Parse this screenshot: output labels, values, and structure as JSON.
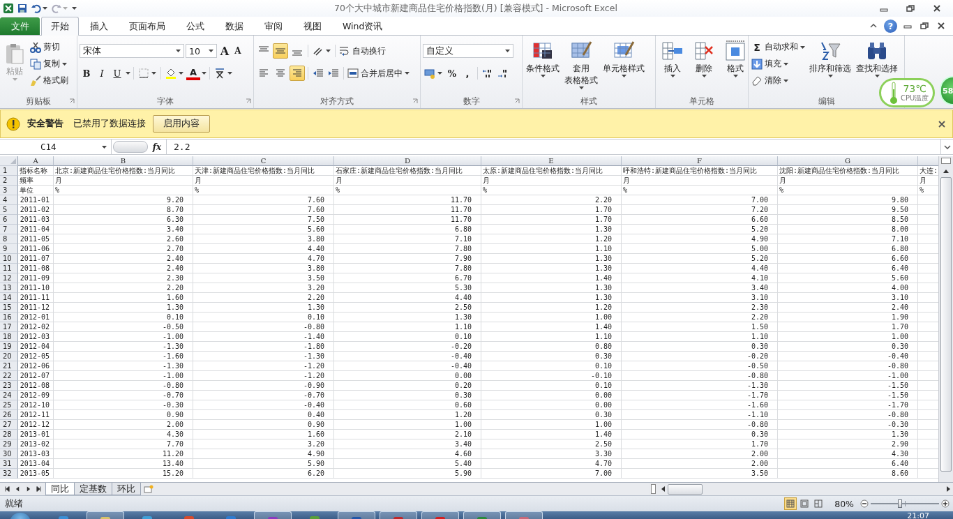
{
  "title_bar": {
    "title": "70个大中城市新建商品住宅价格指数(月)  [兼容模式]  -  Microsoft Excel"
  },
  "ribbon_tabs": [
    {
      "label": "文件",
      "kind": "file",
      "selected": false
    },
    {
      "label": "开始",
      "kind": "tab",
      "selected": true
    },
    {
      "label": "插入",
      "kind": "tab",
      "selected": false
    },
    {
      "label": "页面布局",
      "kind": "tab",
      "selected": false
    },
    {
      "label": "公式",
      "kind": "tab",
      "selected": false
    },
    {
      "label": "数据",
      "kind": "tab",
      "selected": false
    },
    {
      "label": "审阅",
      "kind": "tab",
      "selected": false
    },
    {
      "label": "视图",
      "kind": "tab",
      "selected": false
    },
    {
      "label": "Wind资讯",
      "kind": "tab",
      "selected": false
    }
  ],
  "help_glyph": "?",
  "clipboard": {
    "label": "剪贴板",
    "paste": {
      "label": "粘贴",
      "disabled": true
    },
    "items": [
      {
        "label": "剪切",
        "kind": "cut",
        "dropdown": false
      },
      {
        "label": "复制",
        "kind": "copy",
        "dropdown": true
      },
      {
        "label": "格式刷",
        "kind": "brush",
        "dropdown": false
      }
    ]
  },
  "font": {
    "label": "字体",
    "name": "宋体",
    "size": "10",
    "grow": "A",
    "shrink": "A",
    "styles": [
      {
        "label": "B",
        "kind": "bold"
      },
      {
        "label": "I",
        "kind": "italic"
      },
      {
        "label": "U",
        "kind": "underline"
      }
    ],
    "font_color": "A"
  },
  "alignment": {
    "label": "对齐方式",
    "vertical": [
      {
        "kind": "top",
        "selected": false
      },
      {
        "kind": "middle",
        "selected": true
      },
      {
        "kind": "bottom",
        "selected": false
      }
    ],
    "horizontal": [
      {
        "kind": "left",
        "selected": false
      },
      {
        "kind": "center",
        "selected": false
      },
      {
        "kind": "right",
        "selected": true
      }
    ],
    "wrap": "自动换行",
    "merge": "合并后居中"
  },
  "number": {
    "label": "数字",
    "format": "自定义",
    "percent": "%",
    "comma": ","
  },
  "styles": {
    "label": "样式",
    "items": [
      {
        "lines": [
          "条件格式"
        ],
        "kind": "conditional"
      },
      {
        "lines": [
          "套用",
          "表格格式"
        ],
        "kind": "table"
      },
      {
        "lines": [
          "单元格样式"
        ],
        "kind": "cellstyle"
      }
    ]
  },
  "cells": {
    "label": "单元格",
    "items": [
      {
        "label": "插入",
        "kind": "insert"
      },
      {
        "label": "删除",
        "kind": "delete"
      },
      {
        "label": "格式",
        "kind": "format"
      }
    ]
  },
  "editing": {
    "label": "编辑",
    "sum_glyph": "Σ",
    "small": [
      {
        "label": "自动求和",
        "kind": "sum"
      },
      {
        "label": "填充",
        "kind": "fill"
      },
      {
        "label": "清除",
        "kind": "clear"
      }
    ],
    "large": [
      {
        "label": "排序和筛选",
        "kind": "sort"
      },
      {
        "label": "查找和选择",
        "kind": "find"
      }
    ]
  },
  "cpu_widget": {
    "temperature": "73℃",
    "label": "CPU温度"
  },
  "badge": "58",
  "security_bar": {
    "title": "安全警告",
    "message": "已禁用了数据连接",
    "button": "启用内容"
  },
  "formula_bar": {
    "name_box": "C14",
    "function_glyph": "fx",
    "value": "2.2"
  },
  "sheet": {
    "columns": [
      "A",
      "B",
      "C",
      "D",
      "E",
      "F",
      "G"
    ],
    "rows": [
      {
        "number": "1",
        "kind": "text",
        "cells": [
          "指标名称",
          "北京:新建商品住宅价格指数:当月同比",
          "天津:新建商品住宅价格指数:当月同比",
          "石家庄:新建商品住宅价格指数:当月同比",
          "太原:新建商品住宅价格指数:当月同比",
          "呼和浩特:新建商品住宅价格指数:当月同比",
          "沈阳:新建商品住宅价格指数:当月同比",
          "大连:"
        ]
      },
      {
        "number": "2",
        "kind": "text",
        "cells": [
          "频率",
          "月",
          "月",
          "月",
          "月",
          "月",
          "月",
          "月"
        ]
      },
      {
        "number": "3",
        "kind": "text",
        "cells": [
          "单位",
          "%",
          "%",
          "%",
          "%",
          "%",
          "%",
          "%"
        ]
      },
      {
        "number": "4",
        "kind": "data",
        "cells": [
          "2011-01",
          "9.20",
          "7.60",
          "11.70",
          "2.20",
          "7.00",
          "9.80"
        ]
      },
      {
        "number": "5",
        "kind": "data",
        "cells": [
          "2011-02",
          "8.70",
          "7.60",
          "11.70",
          "1.70",
          "7.20",
          "9.50"
        ]
      },
      {
        "number": "6",
        "kind": "data",
        "cells": [
          "2011-03",
          "6.30",
          "7.50",
          "11.70",
          "1.70",
          "6.60",
          "8.50"
        ]
      },
      {
        "number": "7",
        "kind": "data",
        "cells": [
          "2011-04",
          "3.40",
          "5.60",
          "6.80",
          "1.30",
          "5.20",
          "8.00"
        ]
      },
      {
        "number": "8",
        "kind": "data",
        "cells": [
          "2011-05",
          "2.60",
          "3.80",
          "7.10",
          "1.20",
          "4.90",
          "7.10"
        ]
      },
      {
        "number": "9",
        "kind": "data",
        "cells": [
          "2011-06",
          "2.70",
          "4.40",
          "7.80",
          "1.10",
          "5.00",
          "6.80"
        ]
      },
      {
        "number": "10",
        "kind": "data",
        "cells": [
          "2011-07",
          "2.40",
          "4.70",
          "7.90",
          "1.30",
          "5.20",
          "6.60"
        ]
      },
      {
        "number": "11",
        "kind": "data",
        "cells": [
          "2011-08",
          "2.40",
          "3.80",
          "7.80",
          "1.30",
          "4.40",
          "6.40"
        ]
      },
      {
        "number": "12",
        "kind": "data",
        "cells": [
          "2011-09",
          "2.30",
          "3.50",
          "6.70",
          "1.40",
          "4.10",
          "5.60"
        ]
      },
      {
        "number": "13",
        "kind": "data",
        "cells": [
          "2011-10",
          "2.20",
          "3.20",
          "5.30",
          "1.30",
          "3.40",
          "4.00"
        ]
      },
      {
        "number": "14",
        "kind": "data",
        "cells": [
          "2011-11",
          "1.60",
          "2.20",
          "4.40",
          "1.30",
          "3.10",
          "3.10"
        ]
      },
      {
        "number": "15",
        "kind": "data",
        "cells": [
          "2011-12",
          "1.30",
          "1.30",
          "2.50",
          "1.20",
          "2.30",
          "2.40"
        ]
      },
      {
        "number": "16",
        "kind": "data",
        "cells": [
          "2012-01",
          "0.10",
          "0.10",
          "1.30",
          "1.00",
          "2.20",
          "1.90"
        ]
      },
      {
        "number": "17",
        "kind": "data",
        "cells": [
          "2012-02",
          "-0.50",
          "-0.80",
          "1.10",
          "1.40",
          "1.50",
          "1.70"
        ]
      },
      {
        "number": "18",
        "kind": "data",
        "cells": [
          "2012-03",
          "-1.00",
          "-1.40",
          "0.10",
          "1.10",
          "1.10",
          "1.00"
        ]
      },
      {
        "number": "19",
        "kind": "data",
        "cells": [
          "2012-04",
          "-1.30",
          "-1.80",
          "-0.20",
          "0.80",
          "0.30",
          "0.30"
        ]
      },
      {
        "number": "20",
        "kind": "data",
        "cells": [
          "2012-05",
          "-1.60",
          "-1.30",
          "-0.40",
          "0.30",
          "-0.20",
          "-0.40"
        ]
      },
      {
        "number": "21",
        "kind": "data",
        "cells": [
          "2012-06",
          "-1.30",
          "-1.20",
          "-0.40",
          "0.10",
          "-0.50",
          "-0.80"
        ]
      },
      {
        "number": "22",
        "kind": "data",
        "cells": [
          "2012-07",
          "-1.00",
          "-1.20",
          "0.00",
          "-0.10",
          "-0.80",
          "-1.00"
        ]
      },
      {
        "number": "23",
        "kind": "data",
        "cells": [
          "2012-08",
          "-0.80",
          "-0.90",
          "0.20",
          "0.10",
          "-1.30",
          "-1.50"
        ]
      },
      {
        "number": "24",
        "kind": "data",
        "cells": [
          "2012-09",
          "-0.70",
          "-0.70",
          "0.30",
          "0.00",
          "-1.70",
          "-1.50"
        ]
      },
      {
        "number": "25",
        "kind": "data",
        "cells": [
          "2012-10",
          "-0.30",
          "-0.40",
          "0.60",
          "0.00",
          "-1.60",
          "-1.70"
        ]
      },
      {
        "number": "26",
        "kind": "data",
        "cells": [
          "2012-11",
          "0.90",
          "0.40",
          "1.20",
          "0.30",
          "-1.10",
          "-0.80"
        ]
      },
      {
        "number": "27",
        "kind": "data",
        "cells": [
          "2012-12",
          "2.00",
          "0.90",
          "1.00",
          "1.00",
          "-0.80",
          "-0.30"
        ]
      },
      {
        "number": "28",
        "kind": "data",
        "cells": [
          "2013-01",
          "4.30",
          "1.60",
          "2.10",
          "1.40",
          "0.30",
          "1.30"
        ]
      },
      {
        "number": "29",
        "kind": "data",
        "cells": [
          "2013-02",
          "7.70",
          "3.20",
          "3.40",
          "2.50",
          "1.70",
          "2.90"
        ]
      },
      {
        "number": "30",
        "kind": "data",
        "cells": [
          "2013-03",
          "11.20",
          "4.90",
          "4.60",
          "3.30",
          "2.00",
          "4.30"
        ]
      },
      {
        "number": "31",
        "kind": "data",
        "cells": [
          "2013-04",
          "13.40",
          "5.90",
          "5.40",
          "4.70",
          "2.00",
          "6.40"
        ]
      },
      {
        "number": "32",
        "kind": "data",
        "cells": [
          "2013-05",
          "15.20",
          "6.20",
          "5.90",
          "7.00",
          "3.50",
          "8.60"
        ]
      }
    ]
  },
  "sheet_tabs": [
    {
      "label": "同比",
      "selected": true
    },
    {
      "label": "定基数",
      "selected": false
    },
    {
      "label": "环比",
      "selected": false
    }
  ],
  "status_bar": {
    "status": "就绪",
    "views": [
      {
        "kind": "normal",
        "selected": true
      },
      {
        "kind": "layout",
        "selected": false
      },
      {
        "kind": "pagebreak",
        "selected": false
      }
    ],
    "zoom": "80%",
    "zoom_slider": {
      "level": 0.43
    }
  },
  "taskbar": {
    "time": "21:07",
    "apps": [
      {
        "color": "#3b8fd6"
      },
      {
        "color": "#d9c36a"
      },
      {
        "color": "#3fa0d8"
      },
      {
        "color": "#d84a2a"
      },
      {
        "color": "#2f7bd0"
      },
      {
        "color": "#8a3bc0"
      },
      {
        "color": "#5aa03a"
      },
      {
        "color": "#2356a8"
      },
      {
        "color": "#c0282a"
      },
      {
        "color": "#d42020"
      },
      {
        "color": "#2b8a3e"
      },
      {
        "color": "#c86a7a"
      }
    ]
  }
}
